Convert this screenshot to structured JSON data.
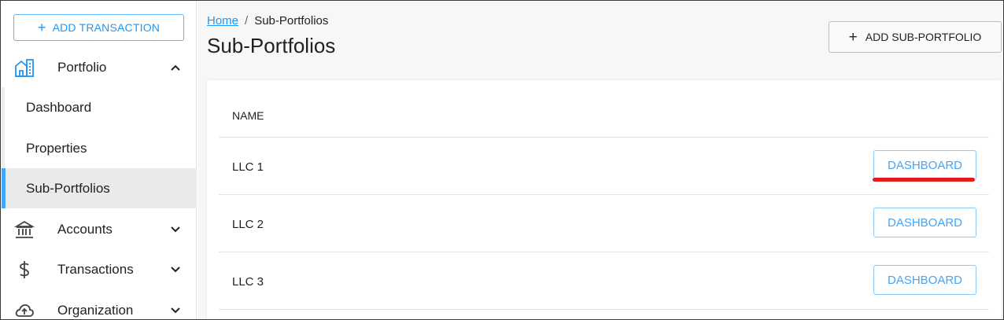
{
  "sidebar": {
    "add_transaction_label": "ADD TRANSACTION",
    "portfolio": {
      "label": "Portfolio",
      "icon": "building-icon",
      "expanded": true
    },
    "portfolio_items": [
      {
        "label": "Dashboard",
        "active": false
      },
      {
        "label": "Properties",
        "active": false
      },
      {
        "label": "Sub-Portfolios",
        "active": true
      }
    ],
    "sections": [
      {
        "label": "Accounts",
        "icon": "bank-icon"
      },
      {
        "label": "Transactions",
        "icon": "dollar-icon"
      },
      {
        "label": "Organization",
        "icon": "cloud-upload-icon"
      }
    ]
  },
  "breadcrumb": {
    "home": "Home",
    "separator": "/",
    "current": "Sub-Portfolios"
  },
  "page": {
    "title": "Sub-Portfolios",
    "add_button_label": "ADD SUB-PORTFOLIO"
  },
  "table": {
    "header": "NAME",
    "rows": [
      {
        "name": "LLC 1",
        "action": "DASHBOARD"
      },
      {
        "name": "LLC 2",
        "action": "DASHBOARD"
      },
      {
        "name": "LLC 3",
        "action": "DASHBOARD"
      }
    ]
  },
  "colors": {
    "accent": "#2196f3",
    "highlight_mark": "#e31b1b",
    "active_bar": "#42a5f5"
  }
}
